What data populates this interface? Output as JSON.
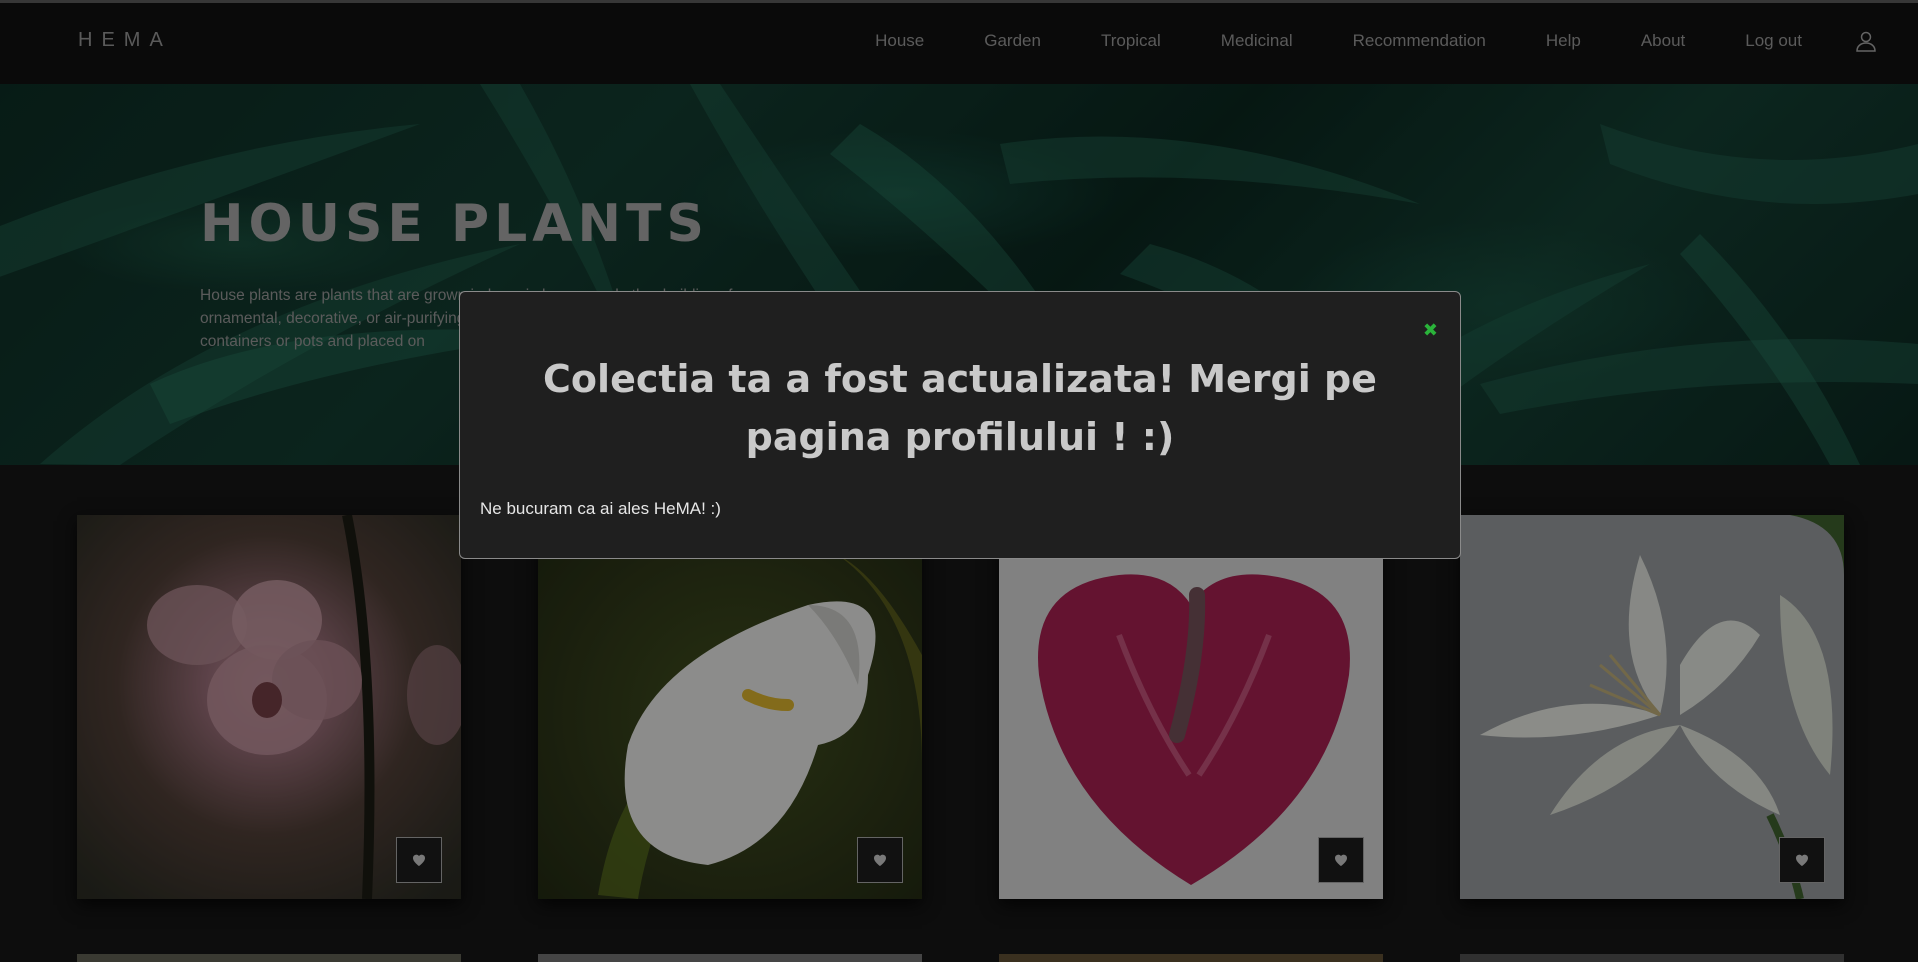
{
  "header": {
    "brand": "HEMA",
    "nav": [
      {
        "label": "House"
      },
      {
        "label": "Garden"
      },
      {
        "label": "Tropical"
      },
      {
        "label": "Medicinal"
      },
      {
        "label": "Recommendation"
      },
      {
        "label": "Help"
      },
      {
        "label": "About"
      },
      {
        "label": "Log out"
      }
    ],
    "user_icon": "user-icon"
  },
  "hero": {
    "title": "HOUSE PLANTS",
    "text": "House plants are plants that are grown indoors in homes and other buildings for ornamental, decorative, or air-purifying purposes. They are typically grown in containers or pots and placed on"
  },
  "products": [
    {
      "name": "orchid",
      "fav_icon": "heart-icon"
    },
    {
      "name": "calla lily",
      "fav_icon": "heart-icon"
    },
    {
      "name": "anthurium",
      "fav_icon": "heart-icon"
    },
    {
      "name": "white lily",
      "fav_icon": "heart-icon"
    }
  ],
  "modal": {
    "close_icon": "close-icon",
    "close_symbol": "✖",
    "heading": "Colectia ta a fost actualizata! Mergi pe pagina profilului ! :)",
    "message": "Ne bucuram ca ai ales HeMA! :)"
  },
  "colors": {
    "close": "#2ab33a",
    "background": "#141414",
    "modal_bg": "#1f1f1f"
  }
}
